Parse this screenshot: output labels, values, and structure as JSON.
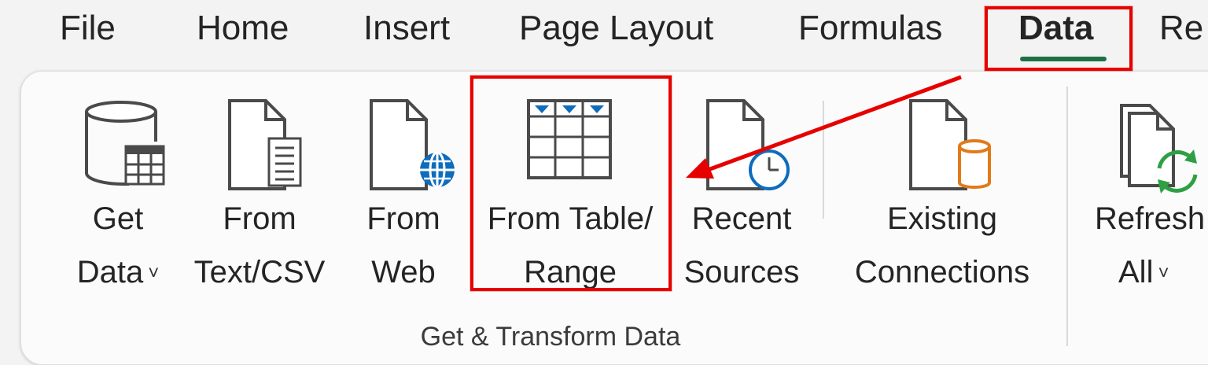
{
  "tabs": [
    "File",
    "Home",
    "Insert",
    "Page Layout",
    "Formulas",
    "Data",
    "Re"
  ],
  "active_tab": "Data",
  "commands": {
    "get_data": {
      "line1": "Get",
      "line2": "Data",
      "chevron": "˅",
      "icon": "database-table-icon"
    },
    "from_text_csv": {
      "line1": "From",
      "line2": "Text/CSV",
      "icon": "text-document-icon"
    },
    "from_web": {
      "line1": "From",
      "line2": "Web",
      "icon": "web-document-icon"
    },
    "from_table_range": {
      "line1": "From Table/",
      "line2": "Range",
      "icon": "table-icon"
    },
    "recent_sources": {
      "line1": "Recent",
      "line2": "Sources",
      "icon": "recent-document-icon"
    },
    "existing_connections": {
      "line1": "Existing",
      "line2": "Connections",
      "icon": "connection-document-icon"
    },
    "refresh_all": {
      "line1": "Refresh",
      "line2": "All",
      "chevron": "˅",
      "icon": "refresh-icon"
    }
  },
  "group_label": "Get & Transform Data",
  "colors": {
    "accent_green": "#1e7145",
    "highlight_red": "#e60000",
    "globe_blue": "#0f6cbd",
    "cylinder_orange": "#e07b19",
    "refresh_green": "#2ea043"
  }
}
